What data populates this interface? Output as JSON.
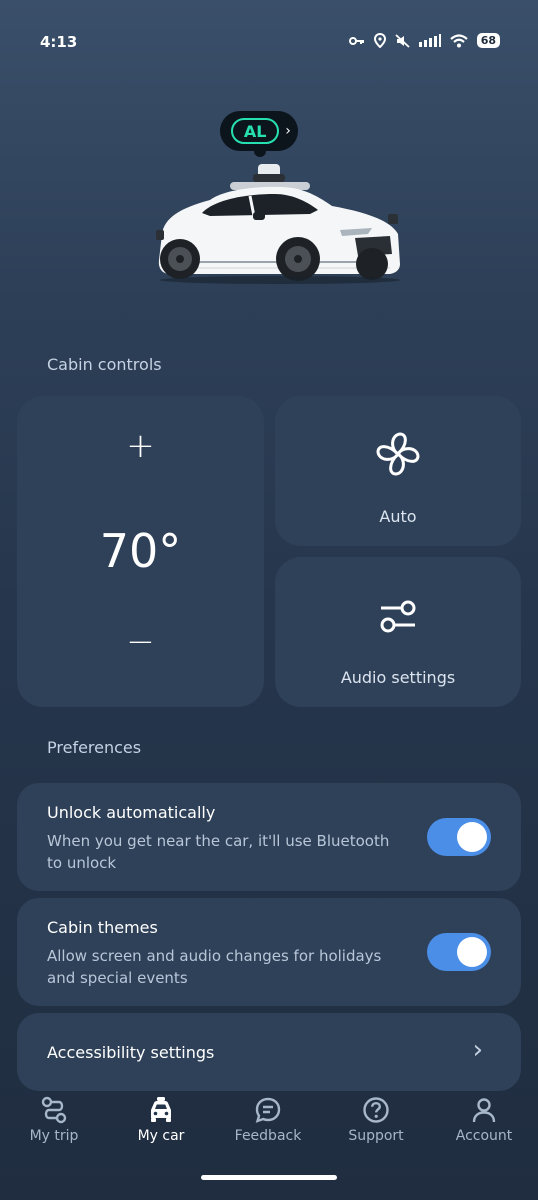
{
  "status_bar": {
    "time": "4:13",
    "battery": "68",
    "icons": [
      "key-icon",
      "location-icon",
      "mute-icon",
      "signal-icon",
      "wifi-icon",
      "battery-icon"
    ]
  },
  "vehicle": {
    "code": "AL",
    "arrow": "›",
    "accent_color": "#27e0b0"
  },
  "cabin_controls": {
    "title": "Cabin controls",
    "temperature": {
      "value": "70°",
      "increase": "+",
      "decrease": "−"
    },
    "fan": {
      "label": "Auto",
      "icon": "fan-icon"
    },
    "audio": {
      "label": "Audio settings",
      "icon": "sliders-icon"
    }
  },
  "preferences": {
    "title": "Preferences",
    "items": [
      {
        "title": "Unlock automatically",
        "description": "When you get near the car, it'll use Bluetooth to unlock",
        "enabled": true
      },
      {
        "title": "Cabin themes",
        "description": "Allow screen and audio changes for holidays and special events",
        "enabled": true
      }
    ],
    "accessibility": {
      "label": "Accessibility settings",
      "arrow": "›"
    }
  },
  "bottom_nav": {
    "items": [
      {
        "label": "My trip",
        "icon": "route-icon",
        "active": false
      },
      {
        "label": "My car",
        "icon": "car-icon",
        "active": true
      },
      {
        "label": "Feedback",
        "icon": "chat-icon",
        "active": false
      },
      {
        "label": "Support",
        "icon": "help-icon",
        "active": false
      },
      {
        "label": "Account",
        "icon": "person-icon",
        "active": false
      }
    ]
  },
  "colors": {
    "toggle_on": "#4a8ee8",
    "card": "#2f4158"
  }
}
